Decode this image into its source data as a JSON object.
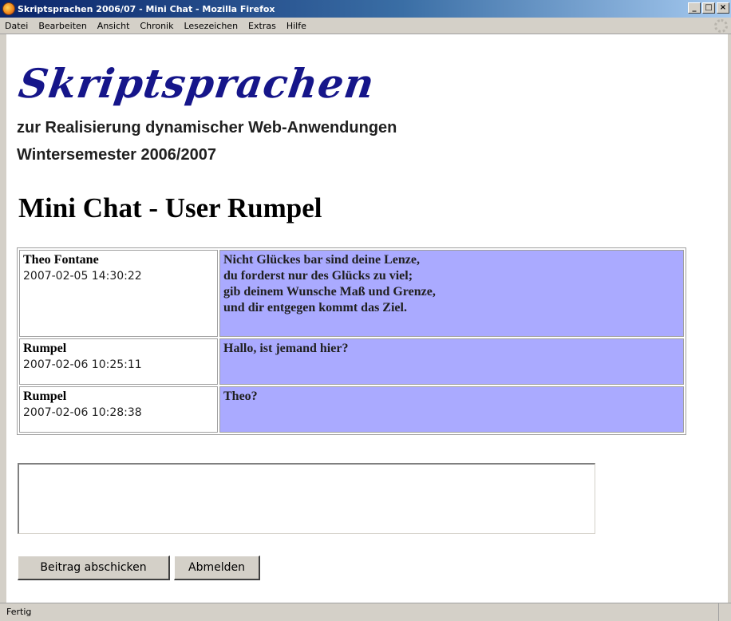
{
  "window": {
    "title": "Skriptsprachen 2006/07 - Mini Chat - Mozilla Firefox",
    "min": "_",
    "max": "□",
    "close": "×"
  },
  "menu": {
    "items": [
      "Datei",
      "Bearbeiten",
      "Ansicht",
      "Chronik",
      "Lesezeichen",
      "Extras",
      "Hilfe"
    ]
  },
  "page": {
    "logo": "Skriptsprachen",
    "subtitle1": "zur Realisierung dynamischer Web-Anwendungen",
    "subtitle2": "Wintersemester 2006/2007",
    "heading": "Mini Chat - User Rumpel"
  },
  "posts": [
    {
      "author": "Theo Fontane",
      "time": "2007-02-05 14:30:22",
      "lines": [
        "Nicht Glückes bar sind deine Lenze,",
        "du forderst nur des Glücks zu viel;",
        "gib deinem Wunsche Maß und Grenze,",
        "und dir entgegen kommt das Ziel."
      ]
    },
    {
      "author": "Rumpel",
      "time": "2007-02-06 10:25:11",
      "lines": [
        "Hallo, ist jemand hier?"
      ]
    },
    {
      "author": "Rumpel",
      "time": "2007-02-06 10:28:38",
      "lines": [
        "Theo?"
      ]
    }
  ],
  "form": {
    "message_value": "",
    "submit_label": "Beitrag abschicken",
    "logout_label": "Abmelden"
  },
  "status": {
    "text": "Fertig"
  },
  "colors": {
    "message_bg": "#aaaaff",
    "logo": "#16168a",
    "titlebar": "#0a246a"
  }
}
